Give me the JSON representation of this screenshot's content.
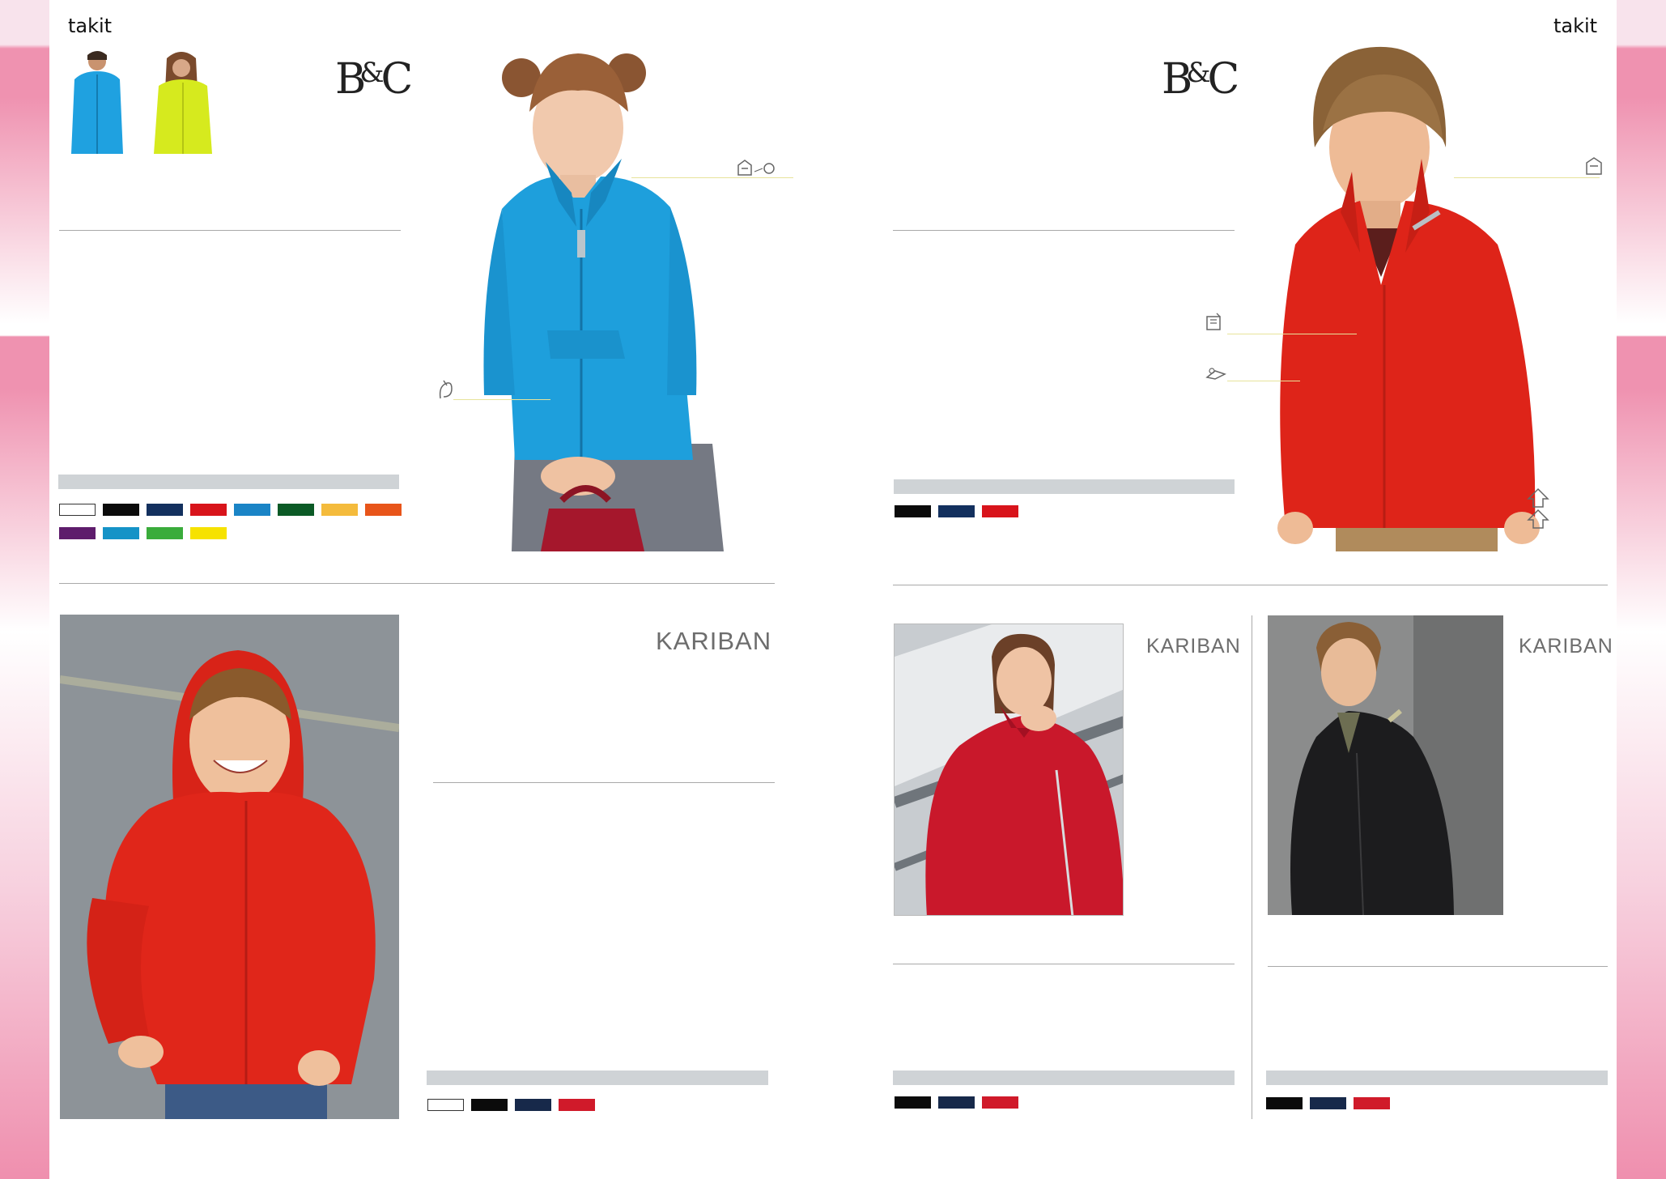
{
  "left_page": {
    "brand": "takit",
    "logo_bc": {
      "main": "B",
      "amp": "&",
      "tail": "C"
    },
    "logo_kariban": "KARIBAN",
    "colors_top": [
      "#ffffff",
      "#0b0b0b",
      "#13305e",
      "#d8141b",
      "#1a84c6",
      "#0b5a26",
      "#f4bb3c",
      "#e8551a",
      "#5e1c6c",
      "#1593c7",
      "#3aac3b",
      "#f6e200"
    ],
    "colors_bottom": [
      "#ffffff",
      "#0b0b0b",
      "#17294a",
      "#d01a2a"
    ]
  },
  "right_page": {
    "brand": "takit",
    "logo_bc": {
      "main": "B",
      "amp": "&",
      "tail": "C"
    },
    "logo_kariban_1": "KARIBAN",
    "logo_kariban_2": "KARIBAN",
    "colors_top": [
      "#0b0b0b",
      "#13305e",
      "#d8141b"
    ],
    "colors_mid": [
      "#0b0b0b",
      "#17294a",
      "#d01a2a"
    ],
    "colors_right": [
      "#0b0b0b",
      "#17294a",
      "#d01a2a"
    ]
  },
  "icons": [
    "zip-pull-icon",
    "elastic-cuff-icon",
    "collar-icon",
    "pocket-icon",
    "sleeve-icon",
    "sizes-icon"
  ]
}
